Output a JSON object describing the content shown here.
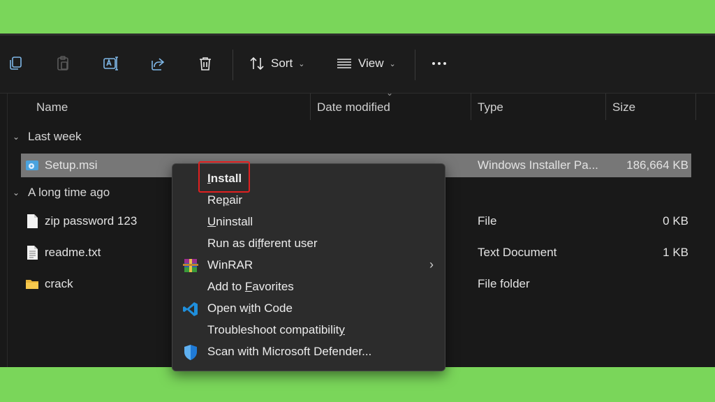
{
  "toolbar": {
    "icons": [
      "copy-icon",
      "paste-icon",
      "rename-icon",
      "share-icon",
      "delete-icon"
    ],
    "sort_label": "Sort",
    "view_label": "View"
  },
  "columns": {
    "name": "Name",
    "date": "Date modified",
    "type": "Type",
    "size": "Size"
  },
  "groups": {
    "last_week": "Last week",
    "long_ago": "A long time ago"
  },
  "files": [
    {
      "name": "Setup.msi",
      "date": "",
      "type": "Windows Installer Pa...",
      "size": "186,664 KB",
      "icon": "installer-icon"
    },
    {
      "name": "zip password 123",
      "date": "",
      "type": "File",
      "size": "0 KB",
      "icon": "file-icon"
    },
    {
      "name": "readme.txt",
      "date": "",
      "type": "Text Document",
      "size": "1 KB",
      "icon": "text-file-icon"
    },
    {
      "name": "crack",
      "date": "",
      "type": "File folder",
      "size": "",
      "icon": "folder-icon"
    }
  ],
  "context_menu": {
    "items": [
      {
        "pre": "",
        "key": "I",
        "post": "nstall"
      },
      {
        "pre": "Re",
        "key": "p",
        "post": "air"
      },
      {
        "pre": "",
        "key": "U",
        "post": "ninstall"
      },
      {
        "pre": "Run as di",
        "key": "f",
        "post": "ferent user"
      },
      {
        "pre": "WinRAR",
        "key": "",
        "post": ""
      },
      {
        "pre": "Add to ",
        "key": "F",
        "post": "avorites"
      },
      {
        "pre": "Open w",
        "key": "i",
        "post": "th Code"
      },
      {
        "pre": "Troubleshoot compatibilit",
        "key": "y",
        "post": ""
      },
      {
        "pre": "Scan with Microsoft Defender...",
        "key": "",
        "post": ""
      }
    ]
  },
  "colors": {
    "background_green": "#7ad65a",
    "highlight_red": "#e02020",
    "selection": "#777777"
  }
}
